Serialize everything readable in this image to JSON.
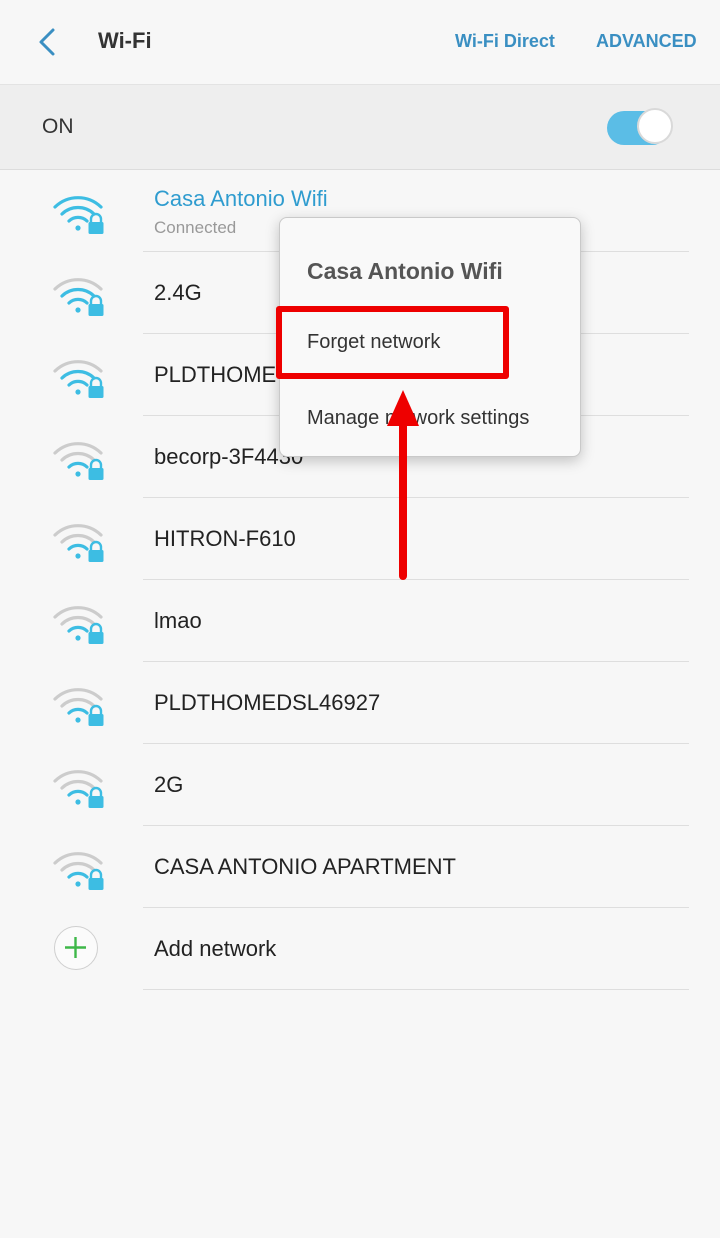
{
  "header": {
    "title": "Wi-Fi",
    "wifi_direct_label": "Wi-Fi Direct",
    "advanced_label": "ADVANCED"
  },
  "master_switch": {
    "label": "ON",
    "state": "on"
  },
  "networks": [
    {
      "name": "Casa Antonio Wifi",
      "status": "Connected",
      "signal": "full",
      "secured": true
    },
    {
      "name": "2.4G",
      "signal": "strong",
      "secured": true
    },
    {
      "name": "PLDTHOME",
      "signal": "strong",
      "secured": true
    },
    {
      "name": "becorp-3F4430",
      "signal": "weak",
      "secured": true
    },
    {
      "name": "HITRON-F610",
      "signal": "weak",
      "secured": true
    },
    {
      "name": "lmao",
      "signal": "weak",
      "secured": true
    },
    {
      "name": "PLDTHOMEDSL46927",
      "signal": "weak",
      "secured": true
    },
    {
      "name": "2G",
      "signal": "weak",
      "secured": true
    },
    {
      "name": "CASA ANTONIO APARTMENT",
      "signal": "weak",
      "secured": true
    }
  ],
  "add_network": {
    "label": "Add network"
  },
  "context_menu": {
    "title": "Casa Antonio Wifi",
    "forget_label": "Forget network",
    "manage_label": "Manage network settings"
  },
  "colors": {
    "accent": "#3a8fc2",
    "connected_text": "#2f9ccf",
    "wifi_active": "#3dbde3",
    "wifi_inactive": "#cccccc",
    "toggle_on": "#5bbde6",
    "annotation_red": "#ee0000",
    "add_icon_green": "#3eb849"
  },
  "icons": {
    "back": "chevron-left-icon",
    "wifi": "wifi-lock-icon",
    "add": "plus-icon"
  }
}
